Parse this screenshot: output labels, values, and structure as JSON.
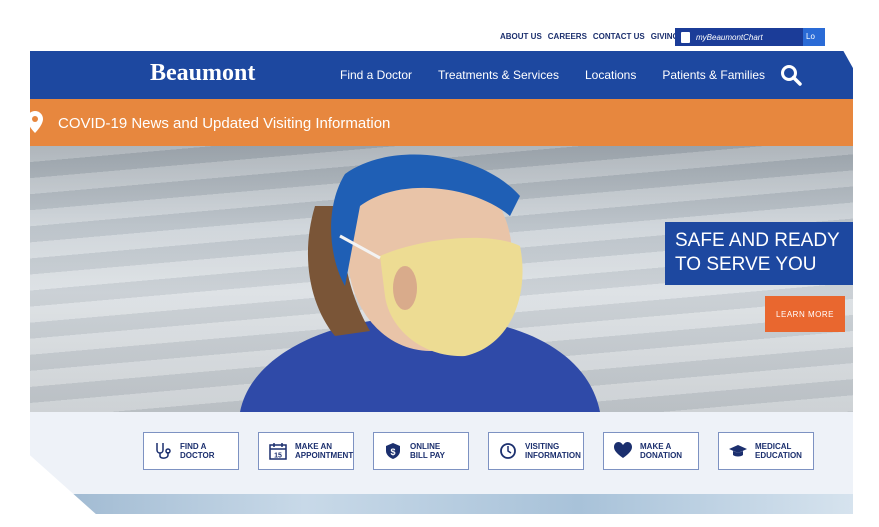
{
  "top_links": [
    "ABOUT US",
    "CAREERS",
    "CONTACT US",
    "GIVING"
  ],
  "chart_button": {
    "label": "myBeaumontChart",
    "login": "Lo"
  },
  "brand": {
    "logo": "Beaumont",
    "color": "#1d48a0",
    "accent": "#e7873e"
  },
  "nav": {
    "items": [
      "Find a Doctor",
      "Treatments & Services",
      "Locations",
      "Patients & Families"
    ],
    "search_icon": "search-icon"
  },
  "covid_banner": {
    "text": "COVID-19 News and Updated Visiting Information",
    "icon": "location-pin-icon"
  },
  "hero": {
    "headline_line1": "SAFE AND READY",
    "headline_line2": "TO SERVE YOU",
    "cta": "LEARN MORE"
  },
  "quick_links": [
    {
      "line1": "FIND A",
      "line2": "DOCTOR",
      "icon": "stethoscope-icon"
    },
    {
      "line1": "MAKE AN",
      "line2": "APPOINTMENT",
      "icon": "calendar-icon"
    },
    {
      "line1": "ONLINE",
      "line2": "BILL PAY",
      "icon": "dollar-shield-icon"
    },
    {
      "line1": "VISITING",
      "line2": "INFORMATION",
      "icon": "clock-icon"
    },
    {
      "line1": "MAKE A",
      "line2": "DONATION",
      "icon": "heart-icon"
    },
    {
      "line1": "MEDICAL",
      "line2": "EDUCATION",
      "icon": "graduation-cap-icon"
    }
  ]
}
